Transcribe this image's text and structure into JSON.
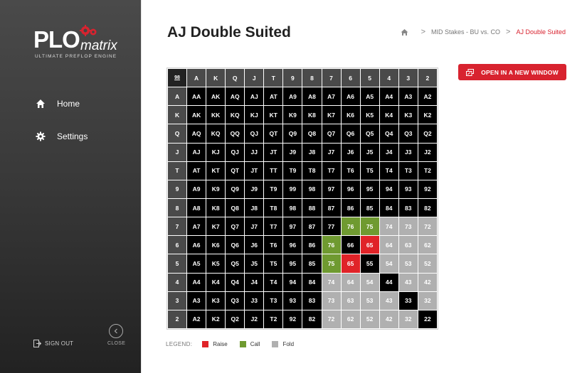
{
  "app": {
    "logo_main": "PLO",
    "logo_sub": "matrix",
    "logo_tagline": "ULTIMATE PREFLOP ENGINE"
  },
  "sidebar": {
    "items": [
      {
        "label": "Home",
        "icon": "home-icon"
      },
      {
        "label": "Settings",
        "icon": "gear-icon"
      }
    ],
    "sign_out": "SIGN OUT",
    "close": "CLOSE"
  },
  "page": {
    "title": "AJ Double Suited",
    "breadcrumb": [
      "MID Stakes - BU vs. CO",
      "AJ Double Suited"
    ],
    "open_button": "OPEN IN A NEW WINDOW"
  },
  "matrix": {
    "corner": "98",
    "columns": [
      "A",
      "K",
      "Q",
      "J",
      "T",
      "9",
      "8",
      "7",
      "6",
      "5",
      "4",
      "3",
      "2"
    ],
    "rows": [
      "A",
      "K",
      "Q",
      "J",
      "T",
      "9",
      "8",
      "7",
      "6",
      "5",
      "4",
      "3",
      "2"
    ],
    "cells": [
      [
        "AA",
        "AK",
        "AQ",
        "AJ",
        "AT",
        "A9",
        "A8",
        "A7",
        "A6",
        "A5",
        "A4",
        "A3",
        "A2"
      ],
      [
        "AK",
        "KK",
        "KQ",
        "KJ",
        "KT",
        "K9",
        "K8",
        "K7",
        "K6",
        "K5",
        "K4",
        "K3",
        "K2"
      ],
      [
        "AQ",
        "KQ",
        "QQ",
        "QJ",
        "QT",
        "Q9",
        "Q8",
        "Q7",
        "Q6",
        "Q5",
        "Q4",
        "Q3",
        "Q2"
      ],
      [
        "AJ",
        "KJ",
        "QJ",
        "JJ",
        "JT",
        "J9",
        "J8",
        "J7",
        "J6",
        "J5",
        "J4",
        "J3",
        "J2"
      ],
      [
        "AT",
        "KT",
        "QT",
        "JT",
        "TT",
        "T9",
        "T8",
        "T7",
        "T6",
        "T5",
        "T4",
        "T3",
        "T2"
      ],
      [
        "A9",
        "K9",
        "Q9",
        "J9",
        "T9",
        "99",
        "98",
        "97",
        "96",
        "95",
        "94",
        "93",
        "92"
      ],
      [
        "A8",
        "K8",
        "Q8",
        "J8",
        "T8",
        "98",
        "88",
        "87",
        "86",
        "85",
        "84",
        "83",
        "82"
      ],
      [
        "A7",
        "K7",
        "Q7",
        "J7",
        "T7",
        "97",
        "87",
        "77",
        "76",
        "75",
        "74",
        "73",
        "72"
      ],
      [
        "A6",
        "K6",
        "Q6",
        "J6",
        "T6",
        "96",
        "86",
        "76",
        "66",
        "65",
        "64",
        "63",
        "62"
      ],
      [
        "A5",
        "K5",
        "Q5",
        "J5",
        "T5",
        "95",
        "85",
        "75",
        "65",
        "55",
        "54",
        "53",
        "52"
      ],
      [
        "A4",
        "K4",
        "Q4",
        "J4",
        "T4",
        "94",
        "84",
        "74",
        "64",
        "54",
        "44",
        "43",
        "42"
      ],
      [
        "A3",
        "K3",
        "Q3",
        "J3",
        "T3",
        "93",
        "83",
        "73",
        "63",
        "53",
        "43",
        "33",
        "32"
      ],
      [
        "A2",
        "K2",
        "Q2",
        "J2",
        "T2",
        "92",
        "82",
        "72",
        "62",
        "52",
        "42",
        "32",
        "22"
      ]
    ],
    "actions": [
      [
        "d",
        "d",
        "d",
        "d",
        "d",
        "d",
        "d",
        "d",
        "d",
        "d",
        "d",
        "d",
        "d"
      ],
      [
        "d",
        "d",
        "d",
        "d",
        "d",
        "d",
        "d",
        "d",
        "d",
        "d",
        "d",
        "d",
        "d"
      ],
      [
        "d",
        "d",
        "d",
        "d",
        "d",
        "d",
        "d",
        "d",
        "d",
        "d",
        "d",
        "d",
        "d"
      ],
      [
        "d",
        "d",
        "d",
        "d",
        "d",
        "d",
        "d",
        "d",
        "d",
        "d",
        "d",
        "d",
        "d"
      ],
      [
        "d",
        "d",
        "d",
        "d",
        "d",
        "d",
        "d",
        "d",
        "d",
        "d",
        "d",
        "d",
        "d"
      ],
      [
        "d",
        "d",
        "d",
        "d",
        "d",
        "d",
        "d",
        "d",
        "d",
        "d",
        "d",
        "d",
        "d"
      ],
      [
        "d",
        "d",
        "d",
        "d",
        "d",
        "d",
        "d",
        "d",
        "d",
        "d",
        "d",
        "d",
        "d"
      ],
      [
        "d",
        "d",
        "d",
        "d",
        "d",
        "d",
        "d",
        "d",
        "c",
        "c",
        "f",
        "f",
        "f"
      ],
      [
        "d",
        "d",
        "d",
        "d",
        "d",
        "d",
        "d",
        "c",
        "d",
        "r",
        "f",
        "f",
        "f"
      ],
      [
        "d",
        "d",
        "d",
        "d",
        "d",
        "d",
        "d",
        "c",
        "r",
        "d",
        "f",
        "f",
        "f"
      ],
      [
        "d",
        "d",
        "d",
        "d",
        "d",
        "d",
        "d",
        "f",
        "f",
        "f",
        "d",
        "f",
        "f"
      ],
      [
        "d",
        "d",
        "d",
        "d",
        "d",
        "d",
        "d",
        "f",
        "f",
        "f",
        "f",
        "d",
        "f"
      ],
      [
        "d",
        "d",
        "d",
        "d",
        "d",
        "d",
        "d",
        "f",
        "f",
        "f",
        "f",
        "f",
        "d"
      ]
    ]
  },
  "legend": {
    "title": "LEGEND:",
    "items": [
      {
        "label": "Raise",
        "color": "#e02328"
      },
      {
        "label": "Call",
        "color": "#6f9a30"
      },
      {
        "label": "Fold",
        "color": "#b0b0b0"
      }
    ]
  },
  "colors": {
    "accent": "#d8232f",
    "raise": "#e02328",
    "call": "#6f9a30",
    "fold": "#b0b0b0",
    "default_cell": "#000000"
  }
}
